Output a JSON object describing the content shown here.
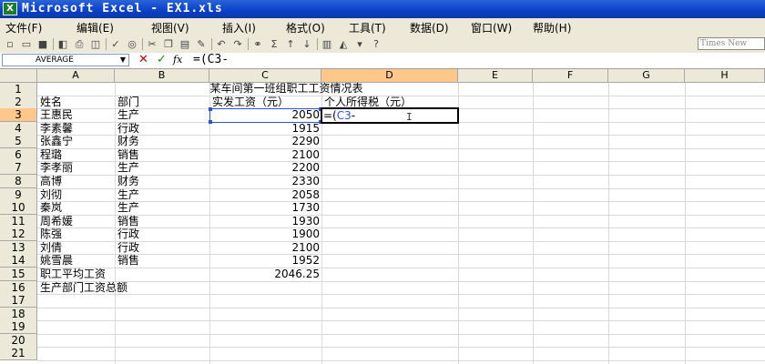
{
  "window": {
    "title": "Microsoft Excel - EX1.xls",
    "icon": "excel-icon"
  },
  "menu": [
    "文件(F)",
    "编辑(E)",
    "视图(V)",
    "插入(I)",
    "格式(O)",
    "工具(T)",
    "数据(D)",
    "窗口(W)",
    "帮助(H)"
  ],
  "toolbar": {
    "font_name": "Times New"
  },
  "formula_bar": {
    "name_box": "AVERAGE",
    "formula": "=(C3-"
  },
  "columns": [
    "A",
    "B",
    "C",
    "D",
    "E",
    "F",
    "G",
    "H"
  ],
  "rows": [
    "1",
    "2",
    "3",
    "4",
    "5",
    "6",
    "7",
    "8",
    "9",
    "10",
    "11",
    "12",
    "13",
    "14",
    "15",
    "16",
    "17",
    "18",
    "19",
    "20",
    "21"
  ],
  "sheet": {
    "title": "某车间第一班组职工工资情况表",
    "headers": {
      "name": "姓名",
      "dept": "部门",
      "salary": "实发工资（元）",
      "tax": "个人所得税（元）"
    },
    "records": [
      {
        "name": "王惠民",
        "dept": "生产",
        "salary": "2050"
      },
      {
        "name": "李素馨",
        "dept": "行政",
        "salary": "1915"
      },
      {
        "name": "张鑫宁",
        "dept": "财务",
        "salary": "2290"
      },
      {
        "name": "程璐",
        "dept": "销售",
        "salary": "2100"
      },
      {
        "name": "李孝丽",
        "dept": "生产",
        "salary": "2200"
      },
      {
        "name": "高博",
        "dept": "财务",
        "salary": "2330"
      },
      {
        "name": "刘彻",
        "dept": "生产",
        "salary": "2058"
      },
      {
        "name": "秦岚",
        "dept": "生产",
        "salary": "1730"
      },
      {
        "name": "周希媛",
        "dept": "销售",
        "salary": "1930"
      },
      {
        "name": "陈强",
        "dept": "行政",
        "salary": "1900"
      },
      {
        "name": "刘倩",
        "dept": "行政",
        "salary": "2100"
      },
      {
        "name": "姚雪晨",
        "dept": "销售",
        "salary": "1952"
      }
    ],
    "avg_label": "职工平均工资",
    "avg_value": "2046.25",
    "prod_total_label": "生产部门工资总额",
    "editing_cell": "D3",
    "editing_content": "=(C3-",
    "editing_ref": "C3"
  },
  "colors": {
    "title_bar": "#0a3fc8",
    "selection": "#2a55d8",
    "header_highlight": "#ffc88a"
  }
}
